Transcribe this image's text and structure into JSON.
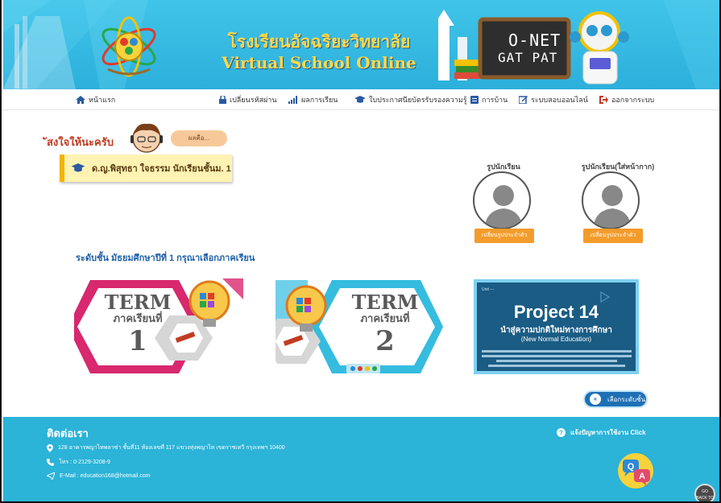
{
  "header": {
    "title_th": "โรงเรียนอัจฉริยะวิทยาลัย",
    "title_en": "Virtual School Online",
    "board_line1": "O-NET",
    "board_line2": "GAT PAT",
    "colors": {
      "sky": "#2cb0dc",
      "title": "#ffd84a"
    }
  },
  "nav": {
    "items": [
      {
        "label": "หน้าแรก",
        "icon": "home-icon"
      },
      {
        "label": "เปลี่ยนรหัสผ่าน",
        "icon": "lock-icon"
      },
      {
        "label": "ผลการเรียน",
        "icon": "signal-icon"
      },
      {
        "label": "ใบประกาศนียบัตรรับรองความรู้",
        "icon": "graduation-cap-icon"
      },
      {
        "label": "การบ้าน",
        "icon": "clipboard-icon"
      },
      {
        "label": "ระบบสอบออนไลน์",
        "icon": "edit-icon"
      },
      {
        "label": "ออกจากระบบ",
        "icon": "sign-out-icon"
      }
    ]
  },
  "main": {
    "welcome": "ัสงใจให้นะครับ",
    "speech": "ผลคือ...",
    "student_name": "ด.ญ.พิสุทธา ใจธรรม นักเรียนชั้นม. 1",
    "photo_caption_left": "รูปนักเรียน",
    "photo_caption_right": "รูปนักเรียน(ใส่หน้ากาก)",
    "photo_btn": "เปลี่ยนรูปประจำตัว",
    "grade_line": "ระดับชั้น มัธยมศึกษาปีที่ 1  กรุณาเลือกภาคเรียน",
    "terms": [
      {
        "word": "TERM",
        "sub": "ภาคเรียนที่",
        "num": "1"
      },
      {
        "word": "TERM",
        "sub": "ภาคเรียนที่",
        "num": "2"
      }
    ],
    "project": {
      "tag": "Unit ---",
      "title": "Project 14",
      "sub": "นำสู่ความปกติใหม่ทางการศึกษา",
      "sub2": "(New Normal Education)"
    },
    "back_button": "เลือกระดับชั้น"
  },
  "footer": {
    "title": "ติดต่อเรา",
    "address": "128 อาคารพญาไทพลาซ่า ชั้นที่11 ห้องเลขที่ 117 แขวงทุ่งพญาไท เขตราชเทวี กรุงเทพฯ 10400",
    "phone": "โทร : 0-2129-3208-9",
    "email": "E-Mail : education168@hotmail.com",
    "help": "แจ้งปัญหาการใช้งาน Click",
    "top_btn": "GO BACK TO TOP"
  }
}
